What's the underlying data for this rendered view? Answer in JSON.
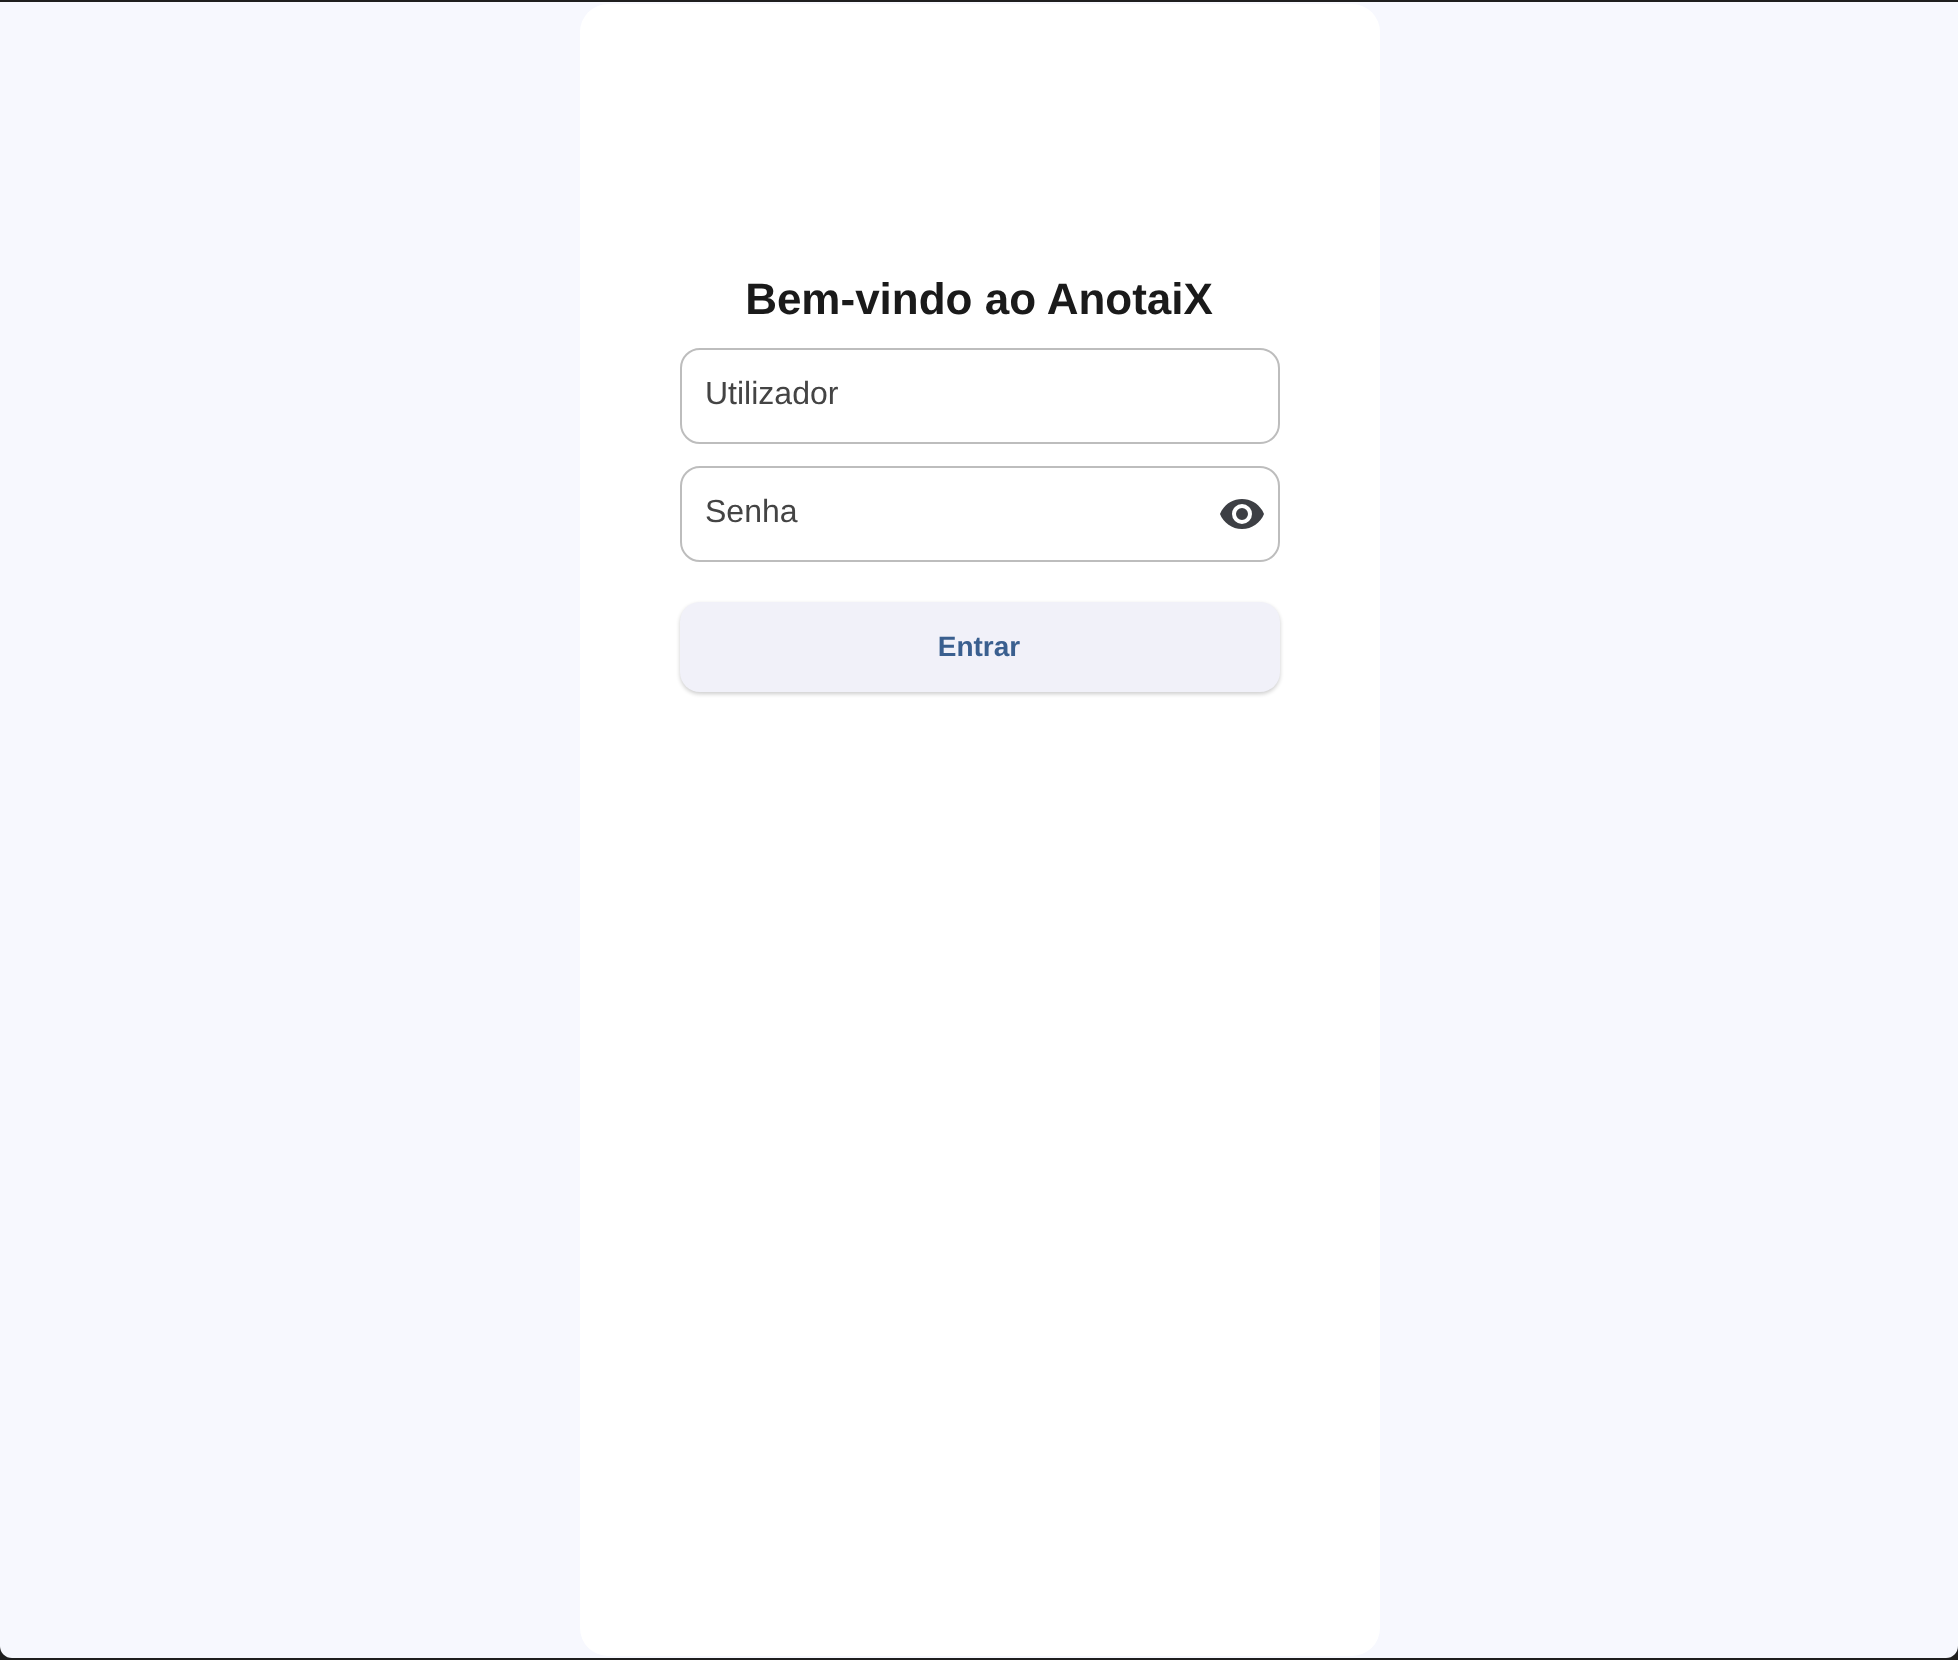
{
  "title": "Bem-vindo ao AnotaiX",
  "fields": [
    {
      "placeholder": "Utilizador",
      "kind": "text"
    },
    {
      "placeholder": "Senha",
      "kind": "password"
    }
  ],
  "submit_button": {
    "label": "Entrar"
  }
}
